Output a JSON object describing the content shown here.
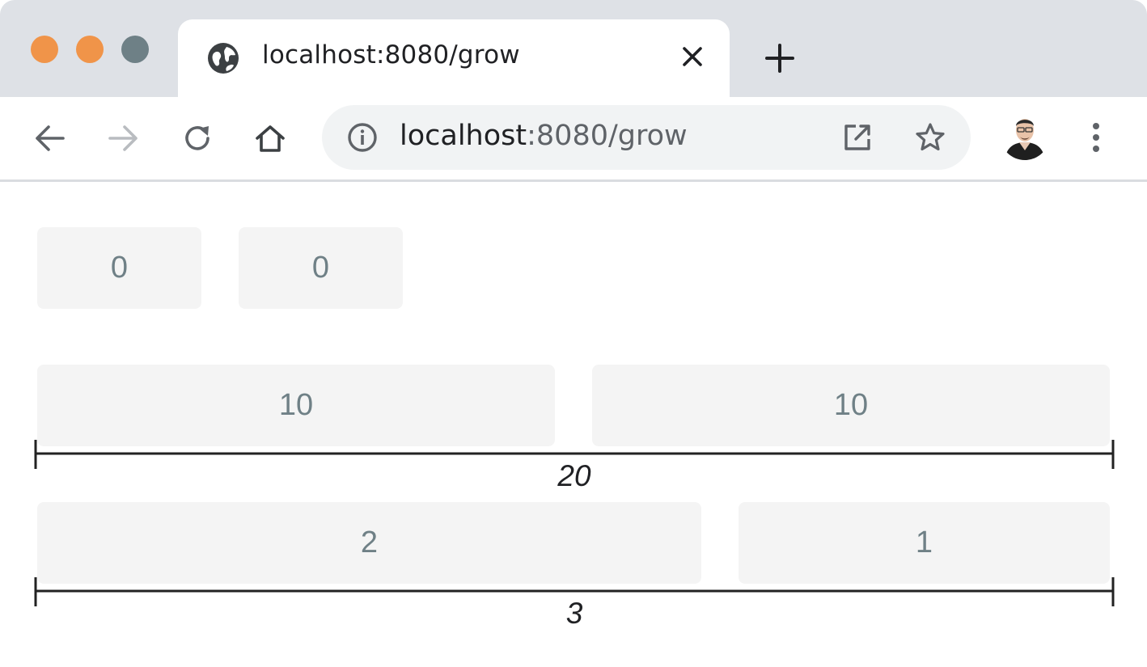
{
  "window": {
    "traffic_light_colors": [
      "#f09449",
      "#f09449",
      "#6e8086"
    ]
  },
  "tab": {
    "title": "localhost:8080/grow",
    "favicon": "globe-icon",
    "close_icon": "close-icon"
  },
  "new_tab_icon": "plus-icon",
  "toolbar": {
    "back_icon": "arrow-left-icon",
    "forward_icon": "arrow-right-icon",
    "reload_icon": "reload-icon",
    "home_icon": "home-icon"
  },
  "omnibox": {
    "info_icon": "info-icon",
    "url_host": "localhost",
    "url_path": ":8080/grow",
    "open_icon": "external-link-icon",
    "bookmark_icon": "star-icon"
  },
  "profile_icon": "avatar",
  "menu_icon": "more-vert-icon",
  "content": {
    "box_color": "#f4f4f4",
    "text_color": "#6f8086",
    "row1": [
      {
        "grow": "0"
      },
      {
        "grow": "0"
      }
    ],
    "row2": [
      {
        "grow": "10"
      },
      {
        "grow": "10"
      }
    ],
    "row2_total": "20",
    "row3": [
      {
        "grow": "2"
      },
      {
        "grow": "1"
      }
    ],
    "row3_total": "3"
  }
}
